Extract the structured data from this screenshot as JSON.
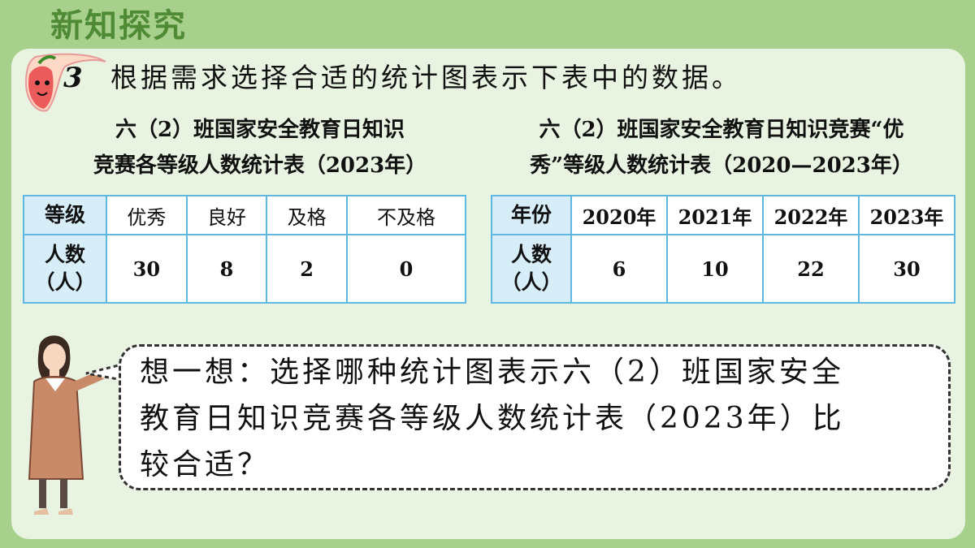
{
  "header": {
    "title": "新知探究"
  },
  "problem": {
    "number": "3",
    "text": "根据需求选择合适的统计图表示下表中的数据。"
  },
  "table_left": {
    "title_line1": "六（2）班国家安全教育日知识",
    "title_line2": "竞赛各等级人数统计表（2023年）",
    "header_label": "等级",
    "columns": [
      "优秀",
      "良好",
      "及格",
      "不及格"
    ],
    "row_label_line1": "人数",
    "row_label_line2": "（人）",
    "values": [
      "30",
      "8",
      "2",
      "0"
    ]
  },
  "table_right": {
    "title_line1": "六（2）班国家安全教育日知识竞赛“优",
    "title_line2": "秀”等级人数统计表（2020—2023年）",
    "header_label": "年份",
    "columns": [
      "2020年",
      "2021年",
      "2022年",
      "2023年"
    ],
    "row_label_line1": "人数",
    "row_label_line2": "（人）",
    "values": [
      "6",
      "10",
      "22",
      "30"
    ]
  },
  "speech": {
    "line1": "想一想：选择哪种统计图表示六（2）班国家安全",
    "line2": "教育日知识竞赛各等级人数统计表（2023年）比",
    "line3": "较合适？"
  },
  "colors": {
    "background": "#a8d08d",
    "panel": "#e9f3e2",
    "title_green": "#4f8a35",
    "table_border": "#5eb8e0",
    "table_header_fill": "#d7eef9"
  },
  "icons": [
    "mascot-pepper-icon",
    "teacher-figure-icon"
  ]
}
